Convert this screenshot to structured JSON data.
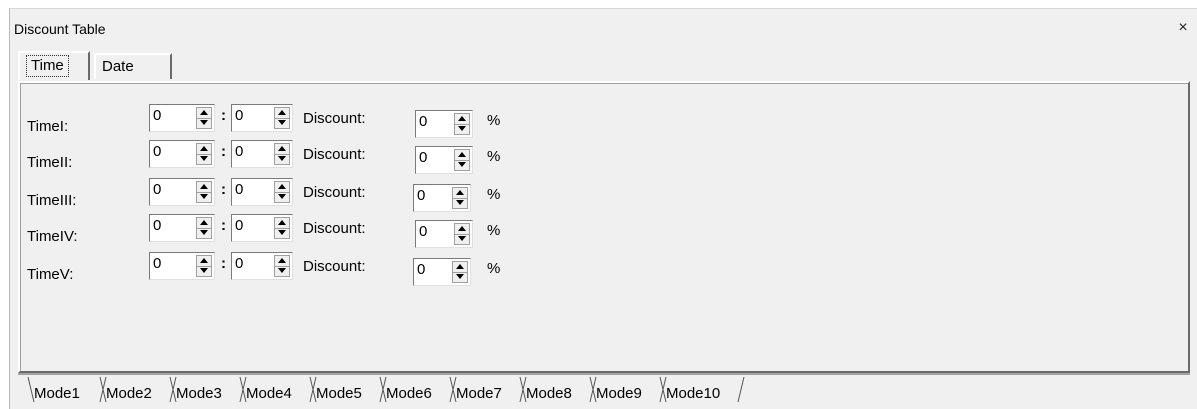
{
  "window": {
    "title": "Discount Table",
    "close_glyph": "×"
  },
  "top_tabs": [
    {
      "label": "Time",
      "active": true
    },
    {
      "label": "Date",
      "active": false
    }
  ],
  "rows": [
    {
      "label": "TimeI:",
      "hour": "0",
      "minute": "0",
      "discount_label": "Discount:",
      "discount": "0",
      "unit": "%"
    },
    {
      "label": "TimeII:",
      "hour": "0",
      "minute": "0",
      "discount_label": "Discount:",
      "discount": "0",
      "unit": "%"
    },
    {
      "label": "TimeIII:",
      "hour": "0",
      "minute": "0",
      "discount_label": "Discount:",
      "discount": "0",
      "unit": "%"
    },
    {
      "label": "TimeIV:",
      "hour": "0",
      "minute": "0",
      "discount_label": "Discount:",
      "discount": "0",
      "unit": "%"
    },
    {
      "label": "TimeV:",
      "hour": "0",
      "minute": "0",
      "discount_label": "Discount:",
      "discount": "0",
      "unit": "%"
    }
  ],
  "separator": ":",
  "mode_tabs": [
    "Mode1",
    "Mode2",
    "Mode3",
    "Mode4",
    "Mode5",
    "Mode6",
    "Mode7",
    "Mode8",
    "Mode9",
    "Mode10"
  ],
  "active_mode": "Mode1"
}
